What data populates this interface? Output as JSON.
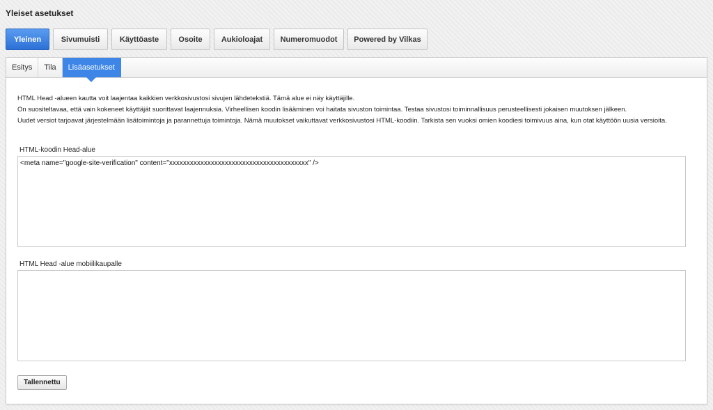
{
  "page": {
    "title": "Yleiset asetukset"
  },
  "top_tabs": [
    {
      "label": "Yleinen",
      "active": true
    },
    {
      "label": "Sivumuisti",
      "active": false
    },
    {
      "label": "Käyttöaste",
      "active": false
    },
    {
      "label": "Osoite",
      "active": false
    },
    {
      "label": "Aukioloajat",
      "active": false
    },
    {
      "label": "Numeromuodot",
      "active": false
    },
    {
      "label": "Powered by Vilkas",
      "active": false
    }
  ],
  "sub_tabs": [
    {
      "label": "Esitys",
      "active": false
    },
    {
      "label": "Tila",
      "active": false
    },
    {
      "label": "Lisäasetukset",
      "active": true
    }
  ],
  "intro": {
    "line1": "HTML Head -alueen kautta voit laajentaa kaikkien verkkosivustosi sivujen lähdetekstiä. Tämä alue ei näy käyttäjille.",
    "line2": "On suositeltavaa, että vain kokeneet käyttäjät suorittavat laajennuksia. Virheellisen koodin lisääminen voi haitata sivuston toimintaa. Testaa sivustosi toiminnallisuus perusteellisesti jokaisen muutoksen jälkeen.",
    "line3": "Uudet versiot tarjoavat järjestelmään lisätoimintoja ja parannettuja toimintoja. Nämä muutokset vaikuttavat verkkosivustosi HTML-koodiin. Tarkista sen vuoksi omien koodiesi toimivuus aina, kun otat käyttöön uusia versioita."
  },
  "head_field": {
    "label": "HTML-koodin Head-alue",
    "value": "<meta name=\"google-site-verification\" content=\"xxxxxxxxxxxxxxxxxxxxxxxxxxxxxxxxxxxxxxxx\" />"
  },
  "mobile_field": {
    "label": "HTML Head -alue mobiilikaupalle",
    "value": ""
  },
  "save_button": {
    "label": "Tallennettu"
  },
  "colors": {
    "accent": "#3d86e8",
    "active_tab": "#2c70d6",
    "page_background": "#ececec"
  }
}
